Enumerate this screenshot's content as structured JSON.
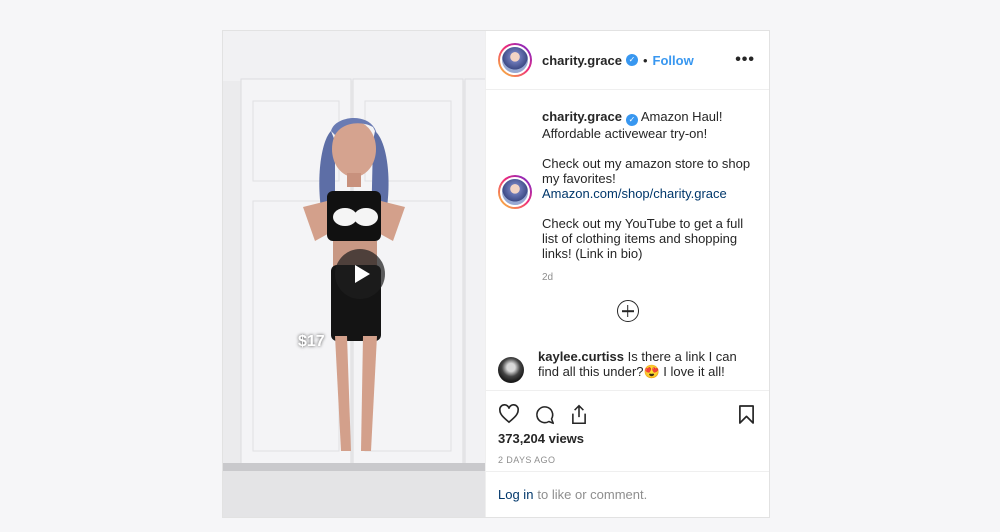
{
  "post": {
    "price_tag": "$17",
    "header": {
      "username": "charity.grace",
      "separator": "•",
      "follow_label": "Follow",
      "more_label": "•••"
    },
    "caption": {
      "username": "charity.grace",
      "line1": "Amazon Haul! Affordable activewear try-on!",
      "line2": "Check out my amazon store to shop my favorites!",
      "link": "Amazon.com/shop/charity.grace",
      "line3": "Check out my YouTube to get a full list of clothing items and shopping links! (Link in bio)",
      "time": "2d"
    },
    "comment": {
      "username": "kaylee.curtiss",
      "text": "Is there a link I can find all this under?😍 I love it all!"
    },
    "views": "373,204 views",
    "posted": "2 DAYS AGO",
    "login": {
      "link": "Log in",
      "text": "to like or comment."
    },
    "colors": {
      "accent": "#3897f0",
      "link": "#00376b",
      "muted": "#8e8e8e"
    }
  }
}
